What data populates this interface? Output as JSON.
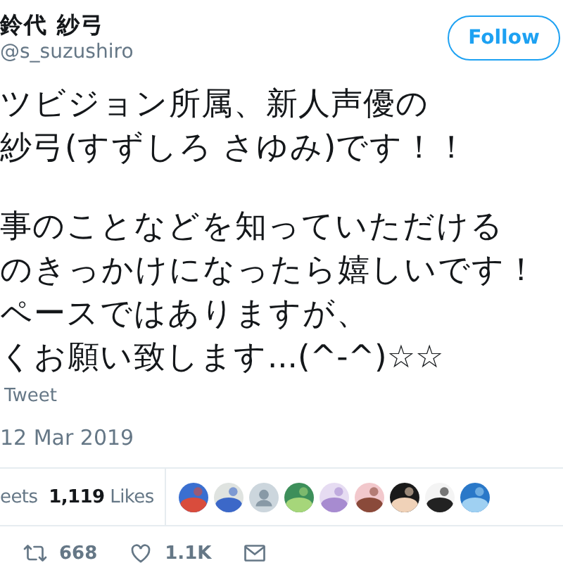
{
  "author": {
    "name": "鈴代 紗弓",
    "handle": "@s_suzushiro"
  },
  "follow_button": "Follow",
  "paragraphs": [
    [
      "ツビジョン所属、新人声優の",
      "紗弓(すずしろ さゆみ)です！！"
    ],
    [
      "事のことなどを知っていただける",
      "のきっかけになったら嬉しいです！",
      "ペースではありますが、",
      "くお願い致します...(^-^)☆☆"
    ]
  ],
  "translate_link": "Tweet",
  "date": "12 Mar 2019",
  "stats": {
    "retweets_label": "eets",
    "likes_count": "1,119",
    "likes_label": "Likes"
  },
  "liked_by": [
    {
      "kind": "picture"
    },
    {
      "kind": "picture"
    },
    {
      "kind": "default"
    },
    {
      "kind": "picture"
    },
    {
      "kind": "picture"
    },
    {
      "kind": "picture"
    },
    {
      "kind": "picture"
    },
    {
      "kind": "picture"
    },
    {
      "kind": "picture"
    }
  ],
  "actions": {
    "retweets": "668",
    "likes": "1.1K"
  }
}
